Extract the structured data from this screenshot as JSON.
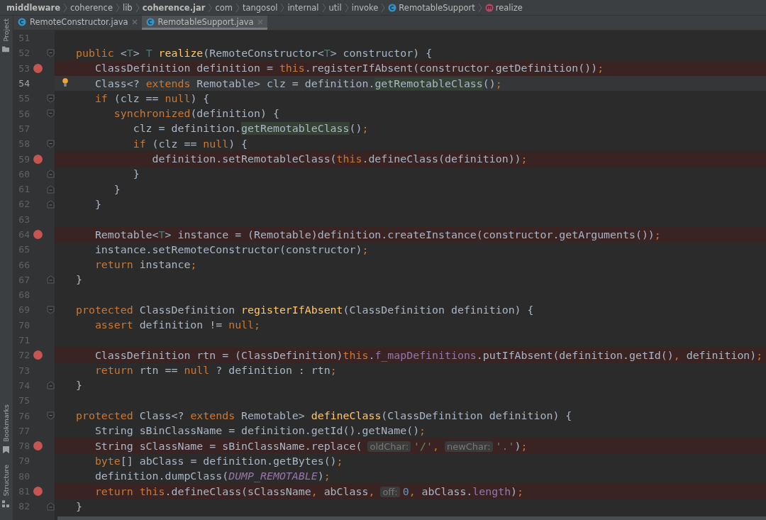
{
  "breadcrumbs": [
    {
      "label": "middleware",
      "kind": "bold"
    },
    {
      "label": "coherence",
      "kind": "plain"
    },
    {
      "label": "lib",
      "kind": "plain"
    },
    {
      "label": "coherence.jar",
      "kind": "bold"
    },
    {
      "label": "com",
      "kind": "plain"
    },
    {
      "label": "tangosol",
      "kind": "plain"
    },
    {
      "label": "internal",
      "kind": "plain"
    },
    {
      "label": "util",
      "kind": "plain"
    },
    {
      "label": "invoke",
      "kind": "plain"
    },
    {
      "label": "RemotableSupport",
      "kind": "class"
    },
    {
      "label": "realize",
      "kind": "method"
    }
  ],
  "tool_strip": {
    "top": [
      {
        "label": "Project",
        "kind": "folder"
      }
    ],
    "bottom": [
      {
        "label": "Bookmarks",
        "kind": "bookmark"
      },
      {
        "label": "Structure",
        "kind": "structure"
      }
    ]
  },
  "tabs": [
    {
      "label": "RemoteConstructor.java",
      "selected": false
    },
    {
      "label": "RemotableSupport.java",
      "selected": true
    }
  ],
  "lines": [
    {
      "number": "51",
      "breakpoint": false,
      "fold_open": false,
      "fold_close": false
    },
    {
      "number": "52",
      "breakpoint": false,
      "fold_open": true,
      "fold_close": false,
      "segments": [
        {
          "kind": "keyword",
          "text": "public "
        },
        {
          "kind": "plain",
          "text": "<"
        },
        {
          "kind": "type",
          "text": "T"
        },
        {
          "kind": "plain",
          "text": "> "
        },
        {
          "kind": "type",
          "text": "T "
        },
        {
          "kind": "declaration",
          "text": "realize"
        },
        {
          "kind": "plain",
          "text": "(RemoteConstructor<"
        },
        {
          "kind": "type",
          "text": "T"
        },
        {
          "kind": "plain",
          "text": "> constructor) {"
        }
      ]
    },
    {
      "number": "53",
      "breakpoint": true,
      "fold_open": false,
      "fold_close": false,
      "segments": [
        {
          "kind": "plain",
          "text": "   ClassDefinition definition = "
        },
        {
          "kind": "keyword",
          "text": "this"
        },
        {
          "kind": "plain",
          "text": ".registerIfAbsent(constructor.getDefinition())"
        },
        {
          "kind": "keyword",
          "text": ";"
        }
      ]
    },
    {
      "number": "54",
      "breakpoint": false,
      "fold_open": false,
      "fold_close": false,
      "caret_line": true,
      "intention_bulb": true,
      "segments": [
        {
          "kind": "plain",
          "text": "   Class<? "
        },
        {
          "kind": "keyword",
          "text": "extends"
        },
        {
          "kind": "plain",
          "text": " Remotable> clz = definition."
        },
        {
          "kind": "usage",
          "text": "getRemotableClass"
        },
        {
          "kind": "plain",
          "text": "()"
        },
        {
          "kind": "keyword",
          "text": ";"
        }
      ]
    },
    {
      "number": "55",
      "breakpoint": false,
      "fold_open": true,
      "fold_close": false,
      "segments": [
        {
          "kind": "keyword",
          "text": "   if"
        },
        {
          "kind": "plain",
          "text": " (clz == "
        },
        {
          "kind": "keyword",
          "text": "null"
        },
        {
          "kind": "plain",
          "text": ") {"
        }
      ]
    },
    {
      "number": "56",
      "breakpoint": false,
      "fold_open": true,
      "fold_close": false,
      "segments": [
        {
          "kind": "keyword",
          "text": "      synchronized"
        },
        {
          "kind": "plain",
          "text": "(definition) {"
        }
      ]
    },
    {
      "number": "57",
      "breakpoint": false,
      "fold_open": false,
      "fold_close": false,
      "segments": [
        {
          "kind": "plain",
          "text": "         clz = definition."
        },
        {
          "kind": "usage",
          "text": "getRemotableClass"
        },
        {
          "kind": "plain",
          "text": "()"
        },
        {
          "kind": "keyword",
          "text": ";"
        }
      ]
    },
    {
      "number": "58",
      "breakpoint": false,
      "fold_open": true,
      "fold_close": false,
      "segments": [
        {
          "kind": "keyword",
          "text": "         if"
        },
        {
          "kind": "plain",
          "text": " (clz == "
        },
        {
          "kind": "keyword",
          "text": "null"
        },
        {
          "kind": "plain",
          "text": ") {"
        }
      ]
    },
    {
      "number": "59",
      "breakpoint": true,
      "fold_open": false,
      "fold_close": false,
      "segments": [
        {
          "kind": "plain",
          "text": "            definition.setRemotableClass("
        },
        {
          "kind": "keyword",
          "text": "this"
        },
        {
          "kind": "plain",
          "text": ".defineClass(definition))"
        },
        {
          "kind": "keyword",
          "text": ";"
        }
      ]
    },
    {
      "number": "60",
      "breakpoint": false,
      "fold_open": false,
      "fold_close": true,
      "segments": [
        {
          "kind": "plain",
          "text": "         }"
        }
      ]
    },
    {
      "number": "61",
      "breakpoint": false,
      "fold_open": false,
      "fold_close": true,
      "segments": [
        {
          "kind": "plain",
          "text": "      }"
        }
      ]
    },
    {
      "number": "62",
      "breakpoint": false,
      "fold_open": false,
      "fold_close": true,
      "segments": [
        {
          "kind": "plain",
          "text": "   }"
        }
      ]
    },
    {
      "number": "63",
      "breakpoint": false,
      "fold_open": false,
      "fold_close": false
    },
    {
      "number": "64",
      "breakpoint": true,
      "fold_open": false,
      "fold_close": false,
      "segments": [
        {
          "kind": "plain",
          "text": "   Remotable<"
        },
        {
          "kind": "type",
          "text": "T"
        },
        {
          "kind": "plain",
          "text": "> instance = (Remotable)definition.createInstance(constructor.getArguments())"
        },
        {
          "kind": "keyword",
          "text": ";"
        }
      ]
    },
    {
      "number": "65",
      "breakpoint": false,
      "fold_open": false,
      "fold_close": false,
      "segments": [
        {
          "kind": "plain",
          "text": "   instance.setRemoteConstructor(constructor)"
        },
        {
          "kind": "keyword",
          "text": ";"
        }
      ]
    },
    {
      "number": "66",
      "breakpoint": false,
      "fold_open": false,
      "fold_close": false,
      "segments": [
        {
          "kind": "keyword",
          "text": "   return"
        },
        {
          "kind": "plain",
          "text": " instance"
        },
        {
          "kind": "keyword",
          "text": ";"
        }
      ]
    },
    {
      "number": "67",
      "breakpoint": false,
      "fold_open": false,
      "fold_close": true,
      "segments": [
        {
          "kind": "plain",
          "text": "}"
        }
      ]
    },
    {
      "number": "68",
      "breakpoint": false,
      "fold_open": false,
      "fold_close": false
    },
    {
      "number": "69",
      "breakpoint": false,
      "fold_open": true,
      "fold_close": false,
      "segments": [
        {
          "kind": "keyword",
          "text": "protected"
        },
        {
          "kind": "plain",
          "text": " ClassDefinition "
        },
        {
          "kind": "declaration",
          "text": "registerIfAbsent"
        },
        {
          "kind": "plain",
          "text": "(ClassDefinition definition) {"
        }
      ]
    },
    {
      "number": "70",
      "breakpoint": false,
      "fold_open": false,
      "fold_close": false,
      "segments": [
        {
          "kind": "keyword",
          "text": "   assert"
        },
        {
          "kind": "plain",
          "text": " definition != "
        },
        {
          "kind": "keyword",
          "text": "null;"
        }
      ]
    },
    {
      "number": "71",
      "breakpoint": false,
      "fold_open": false,
      "fold_close": false
    },
    {
      "number": "72",
      "breakpoint": true,
      "fold_open": false,
      "fold_close": false,
      "segments": [
        {
          "kind": "plain",
          "text": "   ClassDefinition rtn = (ClassDefinition)"
        },
        {
          "kind": "keyword",
          "text": "this"
        },
        {
          "kind": "plain",
          "text": "."
        },
        {
          "kind": "field",
          "text": "f_mapDefinitions"
        },
        {
          "kind": "plain",
          "text": ".putIfAbsent(definition.getId()"
        },
        {
          "kind": "keyword",
          "text": ","
        },
        {
          "kind": "plain",
          "text": " definition)"
        },
        {
          "kind": "keyword",
          "text": ";"
        }
      ]
    },
    {
      "number": "73",
      "breakpoint": false,
      "fold_open": false,
      "fold_close": false,
      "segments": [
        {
          "kind": "keyword",
          "text": "   return"
        },
        {
          "kind": "plain",
          "text": " rtn == "
        },
        {
          "kind": "keyword",
          "text": "null"
        },
        {
          "kind": "plain",
          "text": " ? definition : rtn"
        },
        {
          "kind": "keyword",
          "text": ";"
        }
      ]
    },
    {
      "number": "74",
      "breakpoint": false,
      "fold_open": false,
      "fold_close": true,
      "segments": [
        {
          "kind": "plain",
          "text": "}"
        }
      ]
    },
    {
      "number": "75",
      "breakpoint": false,
      "fold_open": false,
      "fold_close": false
    },
    {
      "number": "76",
      "breakpoint": false,
      "fold_open": true,
      "fold_close": false,
      "segments": [
        {
          "kind": "keyword",
          "text": "protected"
        },
        {
          "kind": "plain",
          "text": " Class<? "
        },
        {
          "kind": "keyword",
          "text": "extends"
        },
        {
          "kind": "plain",
          "text": " Remotable> "
        },
        {
          "kind": "declaration",
          "text": "defineClass"
        },
        {
          "kind": "plain",
          "text": "(ClassDefinition definition) {"
        }
      ]
    },
    {
      "number": "77",
      "breakpoint": false,
      "fold_open": false,
      "fold_close": false,
      "segments": [
        {
          "kind": "plain",
          "text": "   String sBinClassName = definition.getId().getName()"
        },
        {
          "kind": "keyword",
          "text": ";"
        }
      ]
    },
    {
      "number": "78",
      "breakpoint": true,
      "fold_open": false,
      "fold_close": false,
      "segments": [
        {
          "kind": "plain",
          "text": "   String sClassName = sBinClassName.replace("
        },
        {
          "kind": "hint",
          "text": "oldChar:"
        },
        {
          "kind": "string",
          "text": "'/'"
        },
        {
          "kind": "keyword",
          "text": ","
        },
        {
          "kind": "hint",
          "text": "newChar:"
        },
        {
          "kind": "string",
          "text": "'.'"
        },
        {
          "kind": "plain",
          "text": ")"
        },
        {
          "kind": "keyword",
          "text": ";"
        }
      ]
    },
    {
      "number": "79",
      "breakpoint": false,
      "fold_open": false,
      "fold_close": false,
      "segments": [
        {
          "kind": "keyword",
          "text": "   byte"
        },
        {
          "kind": "plain",
          "text": "[] abClass = definition.getBytes()"
        },
        {
          "kind": "keyword",
          "text": ";"
        }
      ]
    },
    {
      "number": "80",
      "breakpoint": false,
      "fold_open": false,
      "fold_close": false,
      "segments": [
        {
          "kind": "plain",
          "text": "   definition.dumpClass("
        },
        {
          "kind": "constant",
          "text": "DUMP_REMOTABLE"
        },
        {
          "kind": "plain",
          "text": ")"
        },
        {
          "kind": "keyword",
          "text": ";"
        }
      ]
    },
    {
      "number": "81",
      "breakpoint": true,
      "fold_open": false,
      "fold_close": false,
      "segments": [
        {
          "kind": "keyword",
          "text": "   return this"
        },
        {
          "kind": "plain",
          "text": ".defineClass(sClassName"
        },
        {
          "kind": "keyword",
          "text": ","
        },
        {
          "kind": "plain",
          "text": " abClass"
        },
        {
          "kind": "keyword",
          "text": ","
        },
        {
          "kind": "hint",
          "text": "off:"
        },
        {
          "kind": "number",
          "text": "0"
        },
        {
          "kind": "keyword",
          "text": ","
        },
        {
          "kind": "plain",
          "text": " abClass."
        },
        {
          "kind": "field",
          "text": "length"
        },
        {
          "kind": "plain",
          "text": ")"
        },
        {
          "kind": "keyword",
          "text": ";"
        }
      ]
    },
    {
      "number": "82",
      "breakpoint": false,
      "fold_open": false,
      "fold_close": true,
      "segments": [
        {
          "kind": "plain",
          "text": "}"
        }
      ]
    }
  ]
}
